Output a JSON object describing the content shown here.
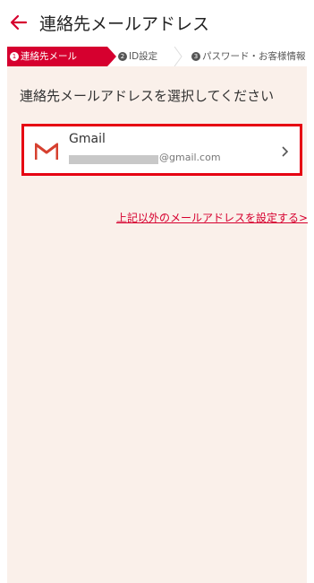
{
  "header": {
    "title": "連絡先メールアドレス"
  },
  "steps": [
    {
      "number": "1",
      "label": "連絡先メール",
      "active": true
    },
    {
      "number": "2",
      "label": "ID設定",
      "active": false
    },
    {
      "number": "3",
      "label": "パスワード・お客様情報",
      "active": false
    }
  ],
  "main": {
    "instruction": "連絡先メールアドレスを選択してください",
    "account": {
      "provider": "Gmail",
      "email_suffix": "@gmail.com",
      "icon": "gmail-icon"
    },
    "other_link": "上記以外のメールアドレスを設定する>"
  },
  "colors": {
    "accent": "#d6002f",
    "highlight_border": "#e60012",
    "background": "#faf0ea"
  }
}
